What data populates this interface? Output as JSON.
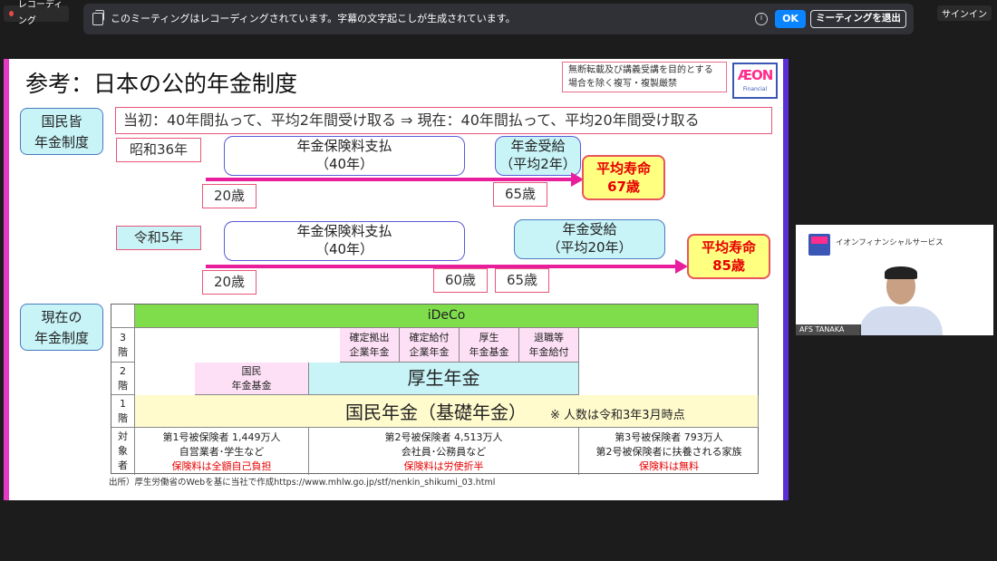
{
  "top": {
    "recording_label": "レコーディング",
    "banner_message": "このミーティングはレコーディングされています。字幕の文字起こしが生成されています。",
    "info_icon": "i",
    "ok_label": "OK",
    "leave_label": "ミーティングを退出",
    "signin_label": "サインイン"
  },
  "slide": {
    "title": "参考：日本の公的年金制度",
    "notice": "無断転載及び講義受講を目的とする場合を除く複写・複製厳禁",
    "logo_text": "ÆON",
    "logo_sub": "Financial",
    "label_universal": "国民皆\n年金制度",
    "summary": "当初：40年間払って、平均2年間受け取る ⇒ 現在：40年間払って、平均20年間受け取る",
    "era1": "昭和36年",
    "pay1": "年金保険料支払\n（40年）",
    "recv1": "年金受給\n（平均2年）",
    "life1": "平均寿命\n67歳",
    "age20_1": "20歳",
    "age65_1": "65歳",
    "era2": "令和5年",
    "pay2": "年金保険料支払\n（40年）",
    "recv2": "年金受給\n（平均20年）",
    "life2": "平均寿命\n85歳",
    "age20_2": "20歳",
    "age60_2": "60歳",
    "age65_2": "65歳",
    "label_current": "現在の\n年金制度",
    "source": "出所）厚生労働省のWebを基に当社で作成https://www.mhlw.go.jp/stf/nenkin_shikumi_03.html"
  },
  "table": {
    "ideco": "iDeCo",
    "tier3": "3\n階",
    "tier2": "2\n階",
    "tier1": "1\n階",
    "subjects": "対\n象\n者",
    "dc": "確定拠出\n企業年金",
    "db": "確定給付\n企業年金",
    "kosei_kikin": "厚生\n年金基金",
    "taishoku": "退職等\n年金給付",
    "kokumin_kikin": "国民\n年金基金",
    "kosei_nenkin": "厚生年金",
    "kiso": "国民年金（基礎年金）",
    "kiso_note": "※ 人数は令和3年3月時点",
    "g1_line1": "第1号被保険者 1,449万人",
    "g1_line2": "自営業者･学生など",
    "g1_line3": "保険料は全額自己負担",
    "g2_line1": "第2号被保険者 4,513万人",
    "g2_line2": "会社員･公務員など",
    "g2_line3": "保険料は労使折半",
    "g3_line1": "第3号被保険者 793万人",
    "g3_line2": "第2号被保険者に扶養される家族",
    "g3_line3": "保険料は無料"
  },
  "webcam": {
    "company": "イオンフィナンシャルサービス",
    "participant_name": "AFS TANAKA"
  },
  "colors": {
    "accent_blue": "#0b84ff",
    "arrow_pink": "#e91e9c",
    "ideco_green": "#7fdd4c",
    "tier_cyan": "#c8f4f8",
    "tier_yellow": "#fffbcc",
    "tier_pink": "#fde0f5"
  }
}
